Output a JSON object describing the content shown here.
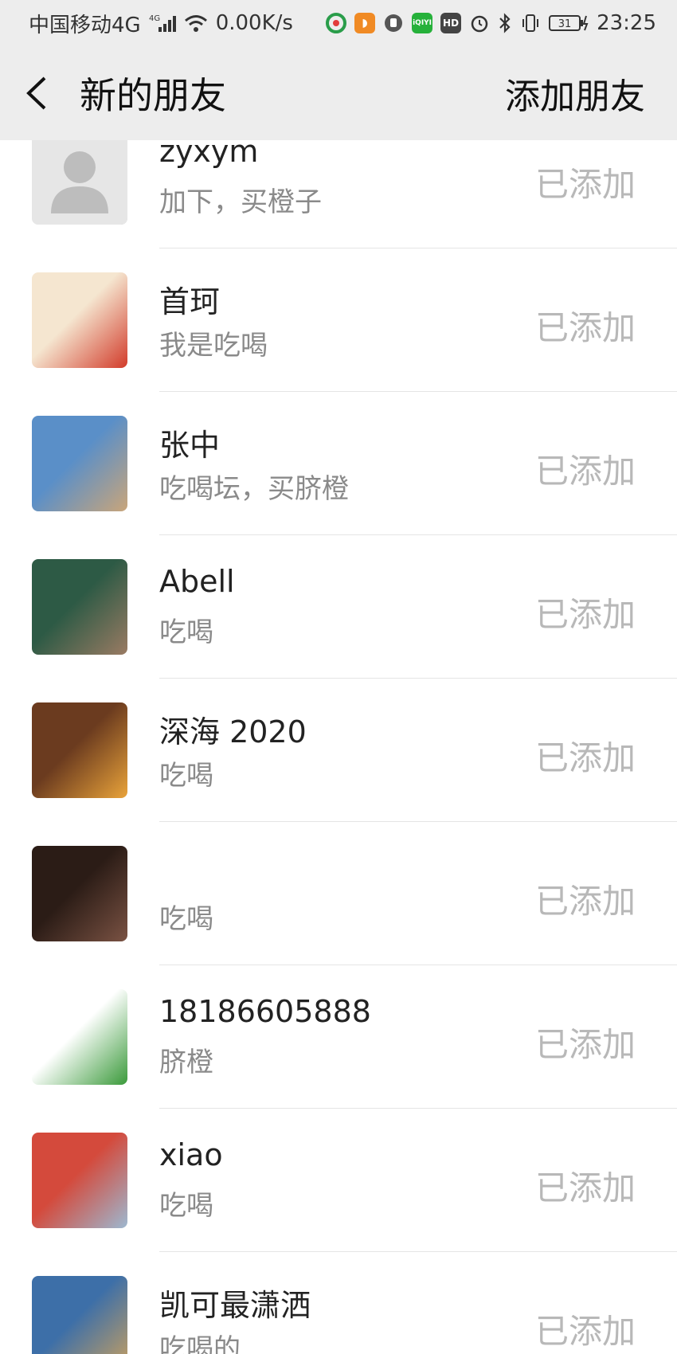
{
  "status_bar": {
    "carrier": "中国移动4G",
    "signal_label": "4G",
    "net_speed": "0.00K/s",
    "hd_label": "HD",
    "iqiyi_label": "iQIYI",
    "battery": "31",
    "time": "23:25"
  },
  "nav": {
    "title": "新的朋友",
    "action_label": "添加朋友"
  },
  "friends": [
    {
      "name": "zyxym",
      "message": "加下，买橙子",
      "status": "已添加",
      "avatar_colors": [
        "#e2e2e2",
        "#c3c3c3"
      ]
    },
    {
      "name": "首珂",
      "message": "我是吃喝",
      "status": "已添加",
      "avatar_colors": [
        "#f5e6d0",
        "#d23b2a"
      ]
    },
    {
      "name": "张中",
      "message": "吃喝坛，买脐橙",
      "status": "已添加",
      "avatar_colors": [
        "#5a8fc8",
        "#c9a57a"
      ]
    },
    {
      "name": "Abell",
      "message": "吃喝",
      "status": "已添加",
      "avatar_colors": [
        "#2d5a45",
        "#9a7b63"
      ]
    },
    {
      "name": "深海 2020",
      "message": "吃喝",
      "status": "已添加",
      "avatar_colors": [
        "#6b3b1f",
        "#e9a33a"
      ]
    },
    {
      "name": "",
      "message": "吃喝",
      "status": "已添加",
      "avatar_colors": [
        "#2b1c16",
        "#7a5243"
      ]
    },
    {
      "name": "18186605888",
      "message": "脐橙",
      "status": "已添加",
      "avatar_colors": [
        "#ffffff",
        "#3a9a3a"
      ]
    },
    {
      "name": "xiao",
      "message": "吃喝",
      "status": "已添加",
      "avatar_colors": [
        "#d44a3c",
        "#9db8d0"
      ]
    },
    {
      "name": "凯可最潇洒",
      "message": "吃喝的",
      "status": "已添加",
      "avatar_colors": [
        "#3d6fa8",
        "#c8a060"
      ]
    }
  ],
  "colors": {
    "header_bg": "#ededed",
    "status_gray": "#b8b8b8",
    "message_gray": "#8a8a8a"
  }
}
